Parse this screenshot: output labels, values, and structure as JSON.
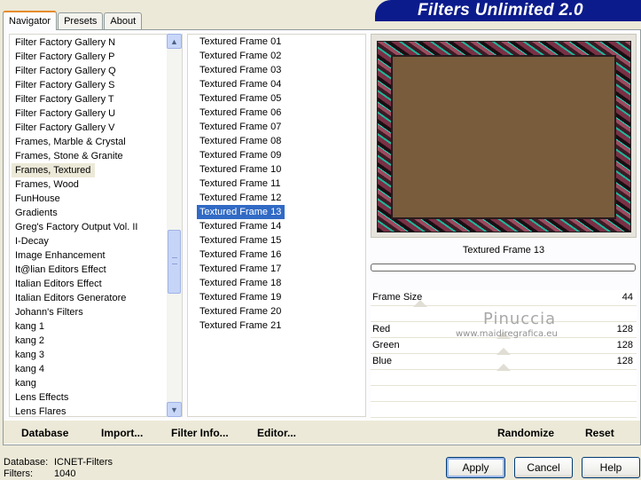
{
  "tabs": [
    {
      "label": "Navigator",
      "active": true
    },
    {
      "label": "Presets",
      "active": false
    },
    {
      "label": "About",
      "active": false
    }
  ],
  "app_title": "Filters Unlimited 2.0",
  "categories": [
    "Filter Factory Gallery N",
    "Filter Factory Gallery P",
    "Filter Factory Gallery Q",
    "Filter Factory Gallery S",
    "Filter Factory Gallery T",
    "Filter Factory Gallery U",
    "Filter Factory Gallery V",
    "Frames, Marble & Crystal",
    "Frames, Stone & Granite",
    "Frames, Textured",
    "Frames, Wood",
    "FunHouse",
    "Gradients",
    "Greg's Factory Output Vol. II",
    "I-Decay",
    "Image Enhancement",
    "It@lian Editors Effect",
    "Italian Editors Effect",
    "Italian Editors Generatore",
    "Johann's Filters",
    "kang 1",
    "kang 2",
    "kang 3",
    "kang 4",
    "kang",
    "Lens Effects",
    "Lens Flares"
  ],
  "selected_category": "Frames, Textured",
  "filters": [
    "Textured Frame 01",
    "Textured Frame 02",
    "Textured Frame 03",
    "Textured Frame 04",
    "Textured Frame 05",
    "Textured Frame 06",
    "Textured Frame 07",
    "Textured Frame 08",
    "Textured Frame 09",
    "Textured Frame 10",
    "Textured Frame 11",
    "Textured Frame 12",
    "Textured Frame 13",
    "Textured Frame 14",
    "Textured Frame 15",
    "Textured Frame 16",
    "Textured Frame 17",
    "Textured Frame 18",
    "Textured Frame 19",
    "Textured Frame 20",
    "Textured Frame 21"
  ],
  "selected_filter": "Textured Frame 13",
  "preview": {
    "filter_name": "Textured Frame 13",
    "inner_color": "#785c3c"
  },
  "params": [
    {
      "label": "Frame Size",
      "value": "44"
    },
    {
      "label": "Red",
      "value": "128"
    },
    {
      "label": "Green",
      "value": "128"
    },
    {
      "label": "Blue",
      "value": "128"
    }
  ],
  "watermark": {
    "name": "Pinuccia",
    "site": "www.maidiregrafica.eu"
  },
  "bottom_links": {
    "database": "Database",
    "import": "Import...",
    "filter_info": "Filter Info...",
    "editor": "Editor...",
    "randomize": "Randomize",
    "reset": "Reset"
  },
  "status": {
    "database_label": "Database:",
    "database_value": "ICNET-Filters",
    "filters_label": "Filters:",
    "filters_value": "1040"
  },
  "buttons": {
    "apply": "Apply",
    "cancel": "Cancel",
    "help": "Help"
  },
  "colors": {
    "title_bg": "#0c1b8c",
    "selection": "#316ac5",
    "tab_accent": "#e68b2c"
  }
}
